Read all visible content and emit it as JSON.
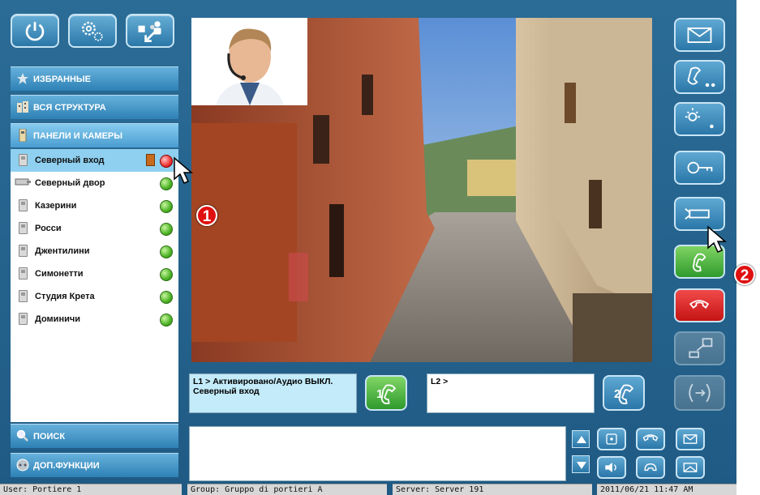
{
  "toolbar": {
    "icons": [
      "power-icon",
      "settings-icon",
      "transfer-users-icon"
    ]
  },
  "nav": {
    "favorites": "ИЗБРАННЫЕ",
    "structure": "ВСЯ СТРУКТУРА",
    "panels": "ПАНЕЛИ И КАМЕРЫ",
    "search": "ПОИСК",
    "extra": "ДОП.ФУНКЦИИ"
  },
  "devices": [
    {
      "name": "Северный вход",
      "status": "red",
      "selected": true,
      "door": true
    },
    {
      "name": "Северный двор",
      "status": "green",
      "camera": true
    },
    {
      "name": "Казерини",
      "status": "green"
    },
    {
      "name": "Росси",
      "status": "green"
    },
    {
      "name": "Джентилини",
      "status": "green"
    },
    {
      "name": "Симонетти",
      "status": "green"
    },
    {
      "name": "Студия Крета",
      "status": "green"
    },
    {
      "name": "Доминичи",
      "status": "green"
    }
  ],
  "lines": {
    "l1_status": "L1 > Активировано/Аудио ВЫКЛ.",
    "l1_device": "Северный вход",
    "l1_button": "1",
    "l2_status": "L2 >",
    "l2_button": "2"
  },
  "callouts": {
    "one": "1",
    "two": "2"
  },
  "status_bar": {
    "user": "User:  Portiere 1",
    "group": "Group:  Gruppo di portieri A",
    "server": "Server:  Server 191",
    "datetime": "2011/06/21  11:47 AM"
  },
  "colors": {
    "background": "#2b6c96",
    "button": "#3f8fc2",
    "selected_row": "#8fd0f0",
    "answer": "#3aa830",
    "hangup": "#d81c1c",
    "callout": "#e01010"
  }
}
